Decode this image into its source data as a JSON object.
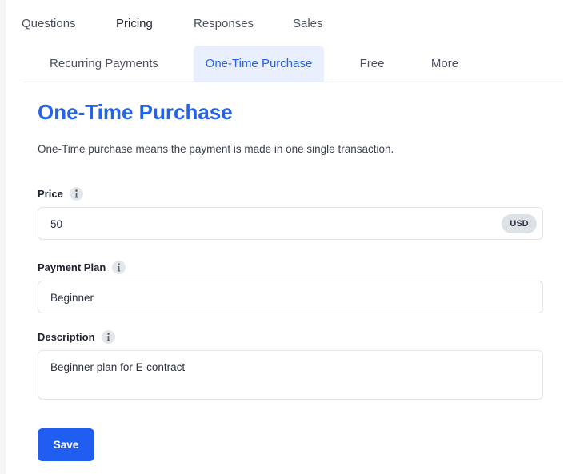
{
  "top_tabs": [
    {
      "label": "Questions",
      "active": false
    },
    {
      "label": "Pricing",
      "active": true
    },
    {
      "label": "Responses",
      "active": false
    },
    {
      "label": "Sales",
      "active": false
    }
  ],
  "sub_tabs": [
    {
      "label": "Recurring Payments",
      "active": false
    },
    {
      "label": "One-Time Purchase",
      "active": true
    },
    {
      "label": "Free",
      "active": false
    },
    {
      "label": "More",
      "active": false
    }
  ],
  "section": {
    "title": "One-Time Purchase",
    "description": "One-Time purchase means the payment is made in one single transaction."
  },
  "fields": {
    "price": {
      "label": "Price",
      "value": "50",
      "currency": "USD"
    },
    "payment_plan": {
      "label": "Payment Plan",
      "value": "Beginner"
    },
    "description": {
      "label": "Description",
      "value": "Beginner plan for E-contract"
    }
  },
  "actions": {
    "save_label": "Save"
  },
  "icons": {
    "info": "info-icon"
  },
  "colors": {
    "accent": "#2563eb",
    "save_button": "#1f5ef0",
    "active_tab_bg": "#e9effd"
  }
}
